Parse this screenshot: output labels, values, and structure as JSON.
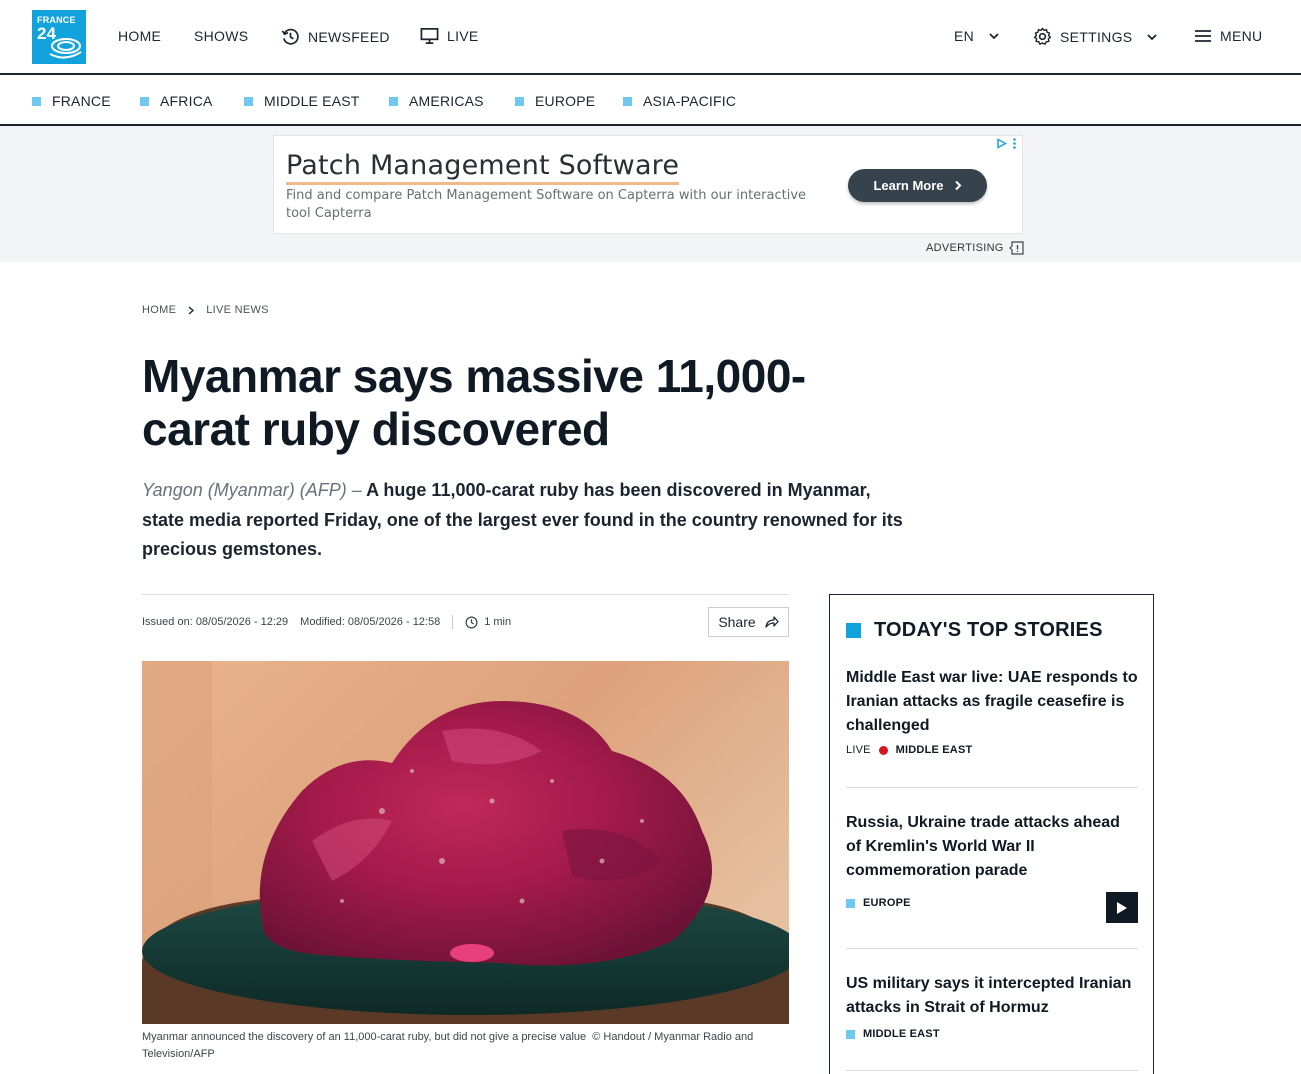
{
  "logo": {
    "line1": "FRANCE",
    "line2": "24"
  },
  "header": {
    "nav": [
      "HOME",
      "SHOWS",
      "NEWSFEED",
      "LIVE"
    ],
    "language": "EN",
    "settings": "SETTINGS",
    "menu": "MENU"
  },
  "regions": [
    "FRANCE",
    "AFRICA",
    "MIDDLE EAST",
    "AMERICAS",
    "EUROPE",
    "ASIA-PACIFIC"
  ],
  "ad": {
    "title": "Patch Management Software",
    "description": "Find and compare Patch Management Software on Capterra with our interactive tool Capterra",
    "button": "Learn More",
    "label": "ADVERTISING"
  },
  "breadcrumb": [
    "HOME",
    "LIVE NEWS"
  ],
  "article": {
    "title": "Myanmar says massive 11,000-carat ruby discovered",
    "dateline": "Yangon (Myanmar) (AFP) –",
    "lead": "A huge 11,000-carat ruby has been discovered in Myanmar, state media reported Friday, one of the largest ever found in the country renowned for its precious gemstones.",
    "issued": "Issued on: 08/05/2026 - 12:29",
    "modified": "Modified: 08/05/2026 - 12:58",
    "read_time": "1 min",
    "share": "Share",
    "caption": "Myanmar announced the discovery of an 11,000-carat ruby, but did not give a precise value",
    "credit": "© Handout / Myanmar Radio and Television/AFP"
  },
  "sidebar": {
    "heading": "TODAY'S TOP STORIES",
    "stories": [
      {
        "title": "Middle East war live: UAE responds to Iranian attacks as fragile ceasefire is challenged",
        "live": "LIVE",
        "tag": "MIDDLE EAST"
      },
      {
        "title": "Russia, Ukraine trade attacks ahead of Kremlin's World War II commemoration parade",
        "tag": "EUROPE"
      },
      {
        "title": "US military says it intercepted Iranian attacks in Strait of Hormuz",
        "tag": "MIDDLE EAST"
      }
    ]
  },
  "colors": {
    "brand": "#12a3dc",
    "region_marker": "#6ec8ef",
    "live_dot": "#d8141c",
    "dark": "#0f1a24"
  }
}
